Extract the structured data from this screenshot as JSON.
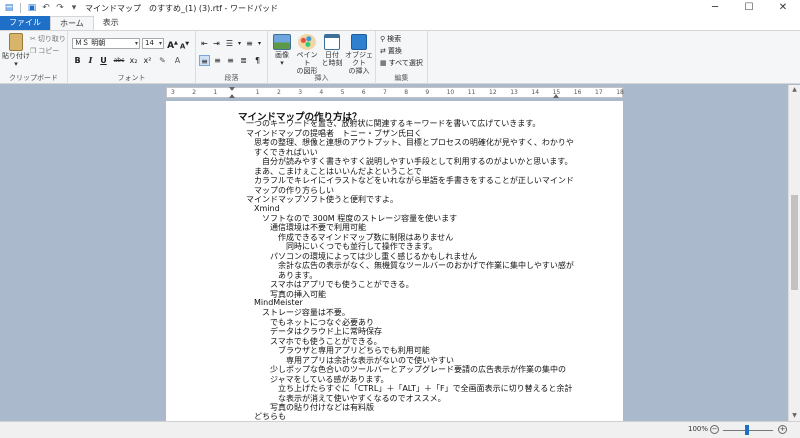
{
  "window": {
    "title": "マインドマップ　のすすめ_(1) (3).rtf - ワードパッド",
    "controls": {
      "minimize": "─",
      "maximize": "☐",
      "close": "✕"
    }
  },
  "tabs": [
    {
      "label": "ファイル"
    },
    {
      "label": "ホーム"
    },
    {
      "label": "表示"
    }
  ],
  "ribbon": {
    "clipboard": {
      "label": "クリップボード",
      "paste": "貼り付け",
      "cut": "切り取り",
      "copy": "コピー"
    },
    "font": {
      "label": "フォント",
      "font_name": "ＭＳ 明朝",
      "font_size": "14",
      "grow": "A",
      "shrink": "A",
      "bold": "B",
      "italic": "I",
      "underline": "U",
      "strike": "abc",
      "subscript": "x₂",
      "superscript": "x²"
    },
    "paragraph": {
      "label": "段落"
    },
    "insert": {
      "label": "挿入",
      "image": "画像",
      "paint": "ペイント",
      "paint2": "の図形",
      "datetime": "日付",
      "datetime2": "と時刻",
      "object": "オブジェクト",
      "object2": "の挿入"
    },
    "edit": {
      "label": "編集",
      "find": "検索",
      "replace": "置換",
      "select_all": "すべて選択"
    }
  },
  "ruler": {
    "ticks": [
      "3",
      "2",
      "1",
      "",
      "1",
      "2",
      "3",
      "4",
      "5",
      "6",
      "7",
      "8",
      "9",
      "10",
      "11",
      "12",
      "13",
      "14",
      "15",
      "16",
      "17",
      "18"
    ]
  },
  "document": {
    "lines": [
      "マインドマップの作り方は？",
      "一つのキーワードを置き、放射状に関連するキーワードを書いて広げていきます。",
      "マインドマップの提唱者　トニー・ブザン氏曰く",
      "思考の整理、想像と連想のアウトプット、目標とプロセスの明確化が見やすく、わかりや",
      "すくできればいい",
      "自分が読みやすく書きやすく説明しやすい手段として利用するのがよいかと思います。",
      "まあ、こまけぇことはいいんだよということで",
      "カラフルでキレイにイラストなどをいれながら単語を手書きをすることが正しいマインド",
      "マップの作り方らしい",
      "マインドマップソフト使うと便利ですよ。",
      "Xmind",
      "ソフトなので 300M 程度のストレージ容量を使います",
      "通信環境は不要で利用可能",
      "作成できるマインドマップ数に制限はありません",
      "同時にいくつでも並行して操作できます。",
      "パソコンの環境によっては少し重く感じるかもしれません",
      "余計な広告の表示がなく、無機質なツールバーのおかげで作業に集中しやすい感が",
      "あります。",
      "スマホはアプリでも使うことができる。",
      "写真の挿入可能",
      "MindMeister",
      "ストレージ容量は不要。",
      "でもネットにつなぐ必要あり",
      "データはクラウド上に常時保存",
      "スマホでも使うことができる。",
      "ブラウザと専用アプリどちらでも利用可能",
      "専用アプリは余計な表示がないので使いやすい",
      "少しポップな色合いのツールバーとアップグレード要請の広告表示が作業の集中の",
      "ジャマをしている感があります。",
      "立ち上げたらすぐに「CTRL」＋「ALT」＋「F」で全画面表示に切り替えると余計",
      "な表示が消えて使いやすくなるのでオススメ。",
      "写真の貼り付けなどは有料版",
      "どちらも"
    ]
  },
  "status": {
    "zoom": "100%",
    "zoom_out": "−",
    "zoom_in": "+"
  },
  "colors": {
    "accent": "#1e6fc8",
    "workspace": "#abb9cc",
    "ribbon": "#f5f6f7"
  }
}
